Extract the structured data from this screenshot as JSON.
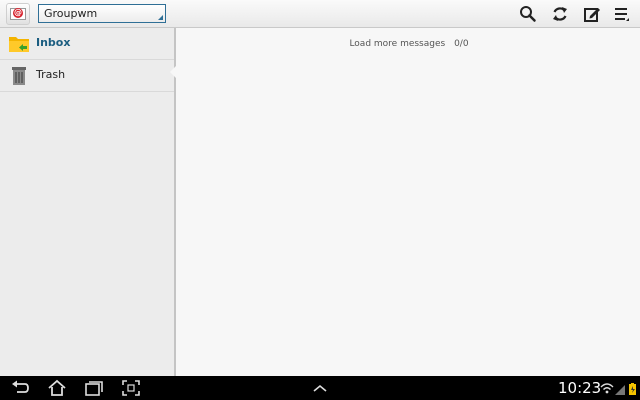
{
  "account": {
    "name": "Groupwm"
  },
  "actions": [
    {
      "icon": "search-icon"
    },
    {
      "icon": "refresh-icon"
    },
    {
      "icon": "compose-icon"
    },
    {
      "icon": "menu-icon"
    }
  ],
  "folders": [
    {
      "label": "Inbox",
      "icon": "inbox-folder-icon",
      "selected": true
    },
    {
      "label": "Trash",
      "icon": "trash-icon",
      "selected": false
    }
  ],
  "message_list": {
    "load_more_label": "Load more messages",
    "count": "0/0"
  },
  "status_bar": {
    "time": "10:23"
  },
  "colors": {
    "accent": "#1b5d80",
    "select_border": "#2f6f96",
    "inbox_folder": "#f4b400",
    "app_badge": "#d6202b"
  }
}
